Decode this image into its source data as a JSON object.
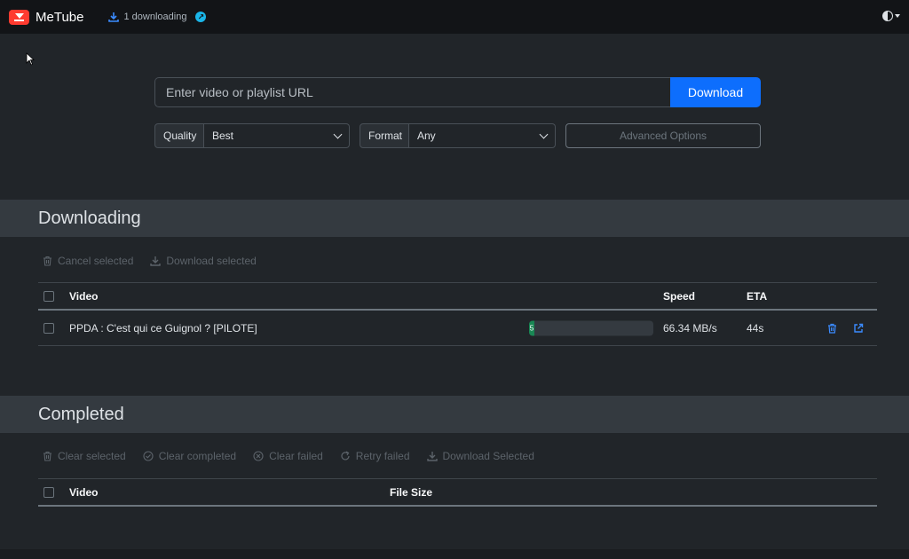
{
  "app": {
    "name": "MeTube",
    "downloading_status": "1 downloading"
  },
  "form": {
    "url_placeholder": "Enter video or playlist URL",
    "download_button": "Download",
    "quality_label": "Quality",
    "quality_value": "Best",
    "format_label": "Format",
    "format_value": "Any",
    "advanced_button": "Advanced Options"
  },
  "downloading": {
    "title": "Downloading",
    "actions": [
      "Cancel selected",
      "Download selected"
    ],
    "columns": {
      "video": "Video",
      "speed": "Speed",
      "eta": "ETA"
    },
    "rows": [
      {
        "title": "PPDA : C'est qui ce Guignol ? [PILOTE]",
        "progress_label": "5",
        "progress_percent": 3,
        "speed": "66.34 MB/s",
        "eta": "44s"
      }
    ]
  },
  "completed": {
    "title": "Completed",
    "actions": [
      "Clear selected",
      "Clear completed",
      "Clear failed",
      "Retry failed",
      "Download Selected"
    ],
    "columns": {
      "video": "Video",
      "file_size": "File Size"
    }
  },
  "colors": {
    "accent": "#0d6efd",
    "progress": "#198754",
    "brand": "#ff3b30",
    "info": "#1ab5e8"
  }
}
